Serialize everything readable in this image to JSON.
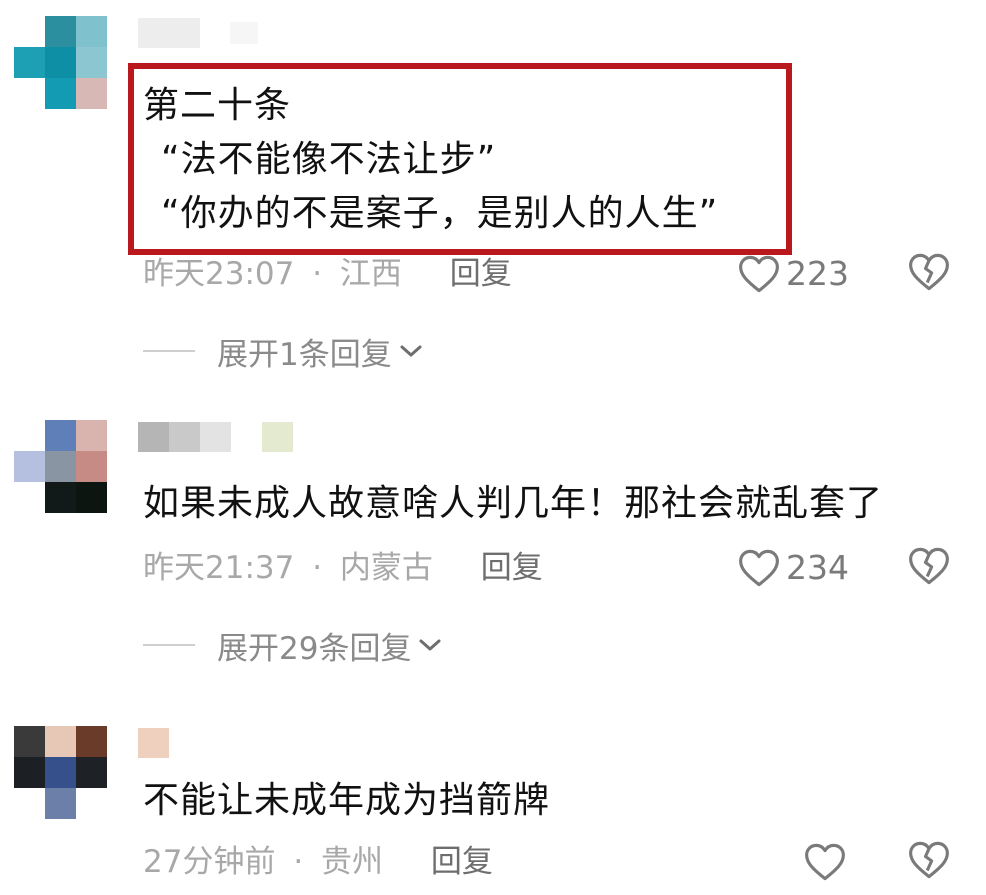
{
  "comments": [
    {
      "lines": [
        "第二十条",
        "“法不能像不法让步”",
        "“你办的不是案子，是别人的人生”"
      ],
      "time": "昨天23:07",
      "sep": "·",
      "location": "江西",
      "reply_label": "回复",
      "likes": "223",
      "expand_label": "展开1条回复"
    },
    {
      "lines": [
        "如果未成人故意啥人判几年！那社会就乱套了"
      ],
      "time": "昨天21:37",
      "sep": "·",
      "location": "内蒙古",
      "reply_label": "回复",
      "likes": "234",
      "expand_label": "展开29条回复"
    },
    {
      "lines": [
        "不能让未成年成为挡箭牌"
      ],
      "time": "27分钟前",
      "sep": "·",
      "location": "贵州",
      "reply_label": "回复",
      "likes": ""
    }
  ],
  "icons": {
    "like": "heart-outline-icon",
    "dislike": "broken-heart-icon",
    "expand": "chevron-down-icon"
  },
  "colors": {
    "highlight_border": "#b9191c",
    "text": "#111111",
    "meta": "#a8a8a8",
    "reply": "#6e6e6e"
  }
}
